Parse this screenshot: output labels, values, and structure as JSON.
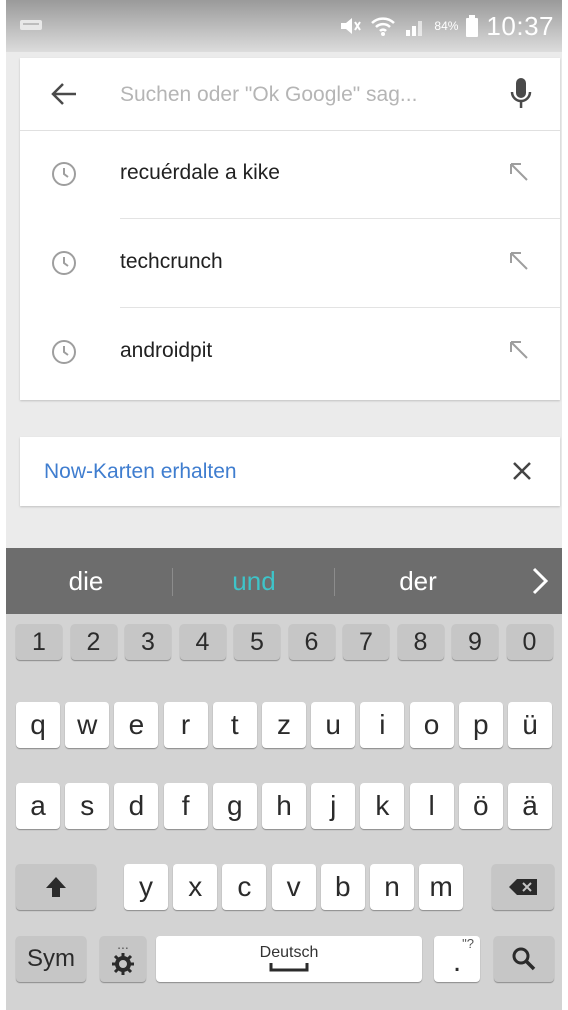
{
  "status_bar": {
    "battery_percent": "84%",
    "time": "10:37"
  },
  "search": {
    "placeholder": "Suchen oder \"Ok Google\" sag...",
    "suggestions": [
      {
        "text": "recuérdale a kike"
      },
      {
        "text": "techcrunch"
      },
      {
        "text": "androidpit"
      }
    ]
  },
  "now_card": {
    "link": "Now-Karten erhalten"
  },
  "keyboard": {
    "suggestion_strip": {
      "left": "die",
      "center": "und",
      "right": "der",
      "center_color": "#3ec4c9"
    },
    "number_row": [
      "1",
      "2",
      "3",
      "4",
      "5",
      "6",
      "7",
      "8",
      "9",
      "0"
    ],
    "row1": [
      "q",
      "w",
      "e",
      "r",
      "t",
      "z",
      "u",
      "i",
      "o",
      "p",
      "ü"
    ],
    "row2": [
      "a",
      "s",
      "d",
      "f",
      "g",
      "h",
      "j",
      "k",
      "l",
      "ö",
      "ä"
    ],
    "row3": [
      "y",
      "x",
      "c",
      "v",
      "b",
      "n",
      "m"
    ],
    "sym_label": "Sym",
    "space_label": "Deutsch",
    "settings_hint": "...",
    "period_label": ".",
    "period_hint": "\"?"
  },
  "icons": {
    "back": "arrow-left-icon",
    "mic": "microphone-icon",
    "history": "clock-icon",
    "fill": "arrow-up-left-icon",
    "close": "close-icon",
    "shift": "shift-icon",
    "backspace": "backspace-icon",
    "settings": "gear-icon",
    "search_key": "search-icon",
    "next": "chevron-right-icon"
  },
  "colors": {
    "link": "#3f7dcf",
    "strip_bg": "#6d6d6d",
    "keyboard_bg": "#d3d3d3"
  }
}
